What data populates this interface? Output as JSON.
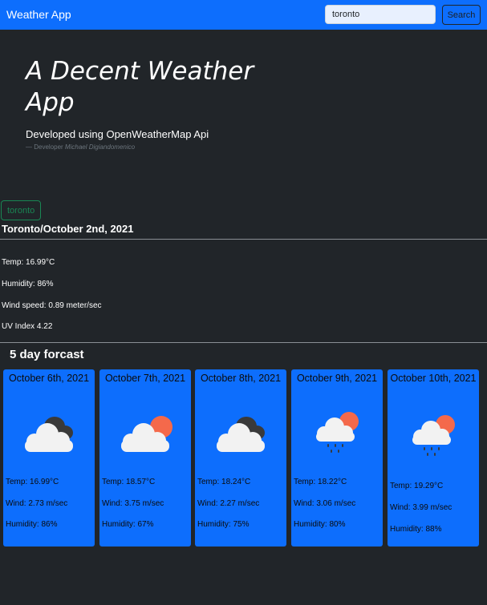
{
  "navbar": {
    "brand": "Weather App",
    "search_value": "toronto",
    "search_button": "Search"
  },
  "hero": {
    "title": "A Decent Weather App",
    "subtitle": "Developed using OpenWeatherMap Api",
    "credit_prefix": "— Developer",
    "credit_name": "Michael Digiandomenico"
  },
  "history": [
    "toronto"
  ],
  "current": {
    "heading": "Toronto/October 2nd, 2021",
    "temp": "Temp: 16.99°C",
    "humidity": "Humidity: 86%",
    "wind": "Wind speed: 0.89 meter/sec",
    "uv": "UV Index 4.22"
  },
  "forecast": {
    "title": "5 day forcast",
    "days": [
      {
        "date": "October 6th, 2021",
        "icon": "cloud-dark-icon",
        "temp": "Temp: 16.99°C",
        "wind": "Wind: 2.73 m/sec",
        "humidity": "Humidity: 86%"
      },
      {
        "date": "October 7th, 2021",
        "icon": "cloud-sun-icon",
        "temp": "Temp: 18.57°C",
        "wind": "Wind: 3.75 m/sec",
        "humidity": "Humidity: 67%"
      },
      {
        "date": "October 8th, 2021",
        "icon": "cloud-dark-icon",
        "temp": "Temp: 18.24°C",
        "wind": "Wind: 2.27 m/sec",
        "humidity": "Humidity: 75%"
      },
      {
        "date": "October 9th, 2021",
        "icon": "rain-sun-icon",
        "temp": "Temp: 18.22°C",
        "wind": "Wind: 3.06 m/sec",
        "humidity": "Humidity: 80%"
      },
      {
        "date": "October 10th, 2021",
        "icon": "rain-sun-icon",
        "temp": "Temp: 19.29°C",
        "wind": "Wind: 3.99 m/sec",
        "humidity": "Humidity: 88%"
      }
    ]
  },
  "colors": {
    "primary": "#0d6efd",
    "background": "#212529",
    "success": "#198754",
    "sun": "#f4694b",
    "cloud": "#f2f2f2",
    "dark_cloud": "#3a3a3a"
  }
}
